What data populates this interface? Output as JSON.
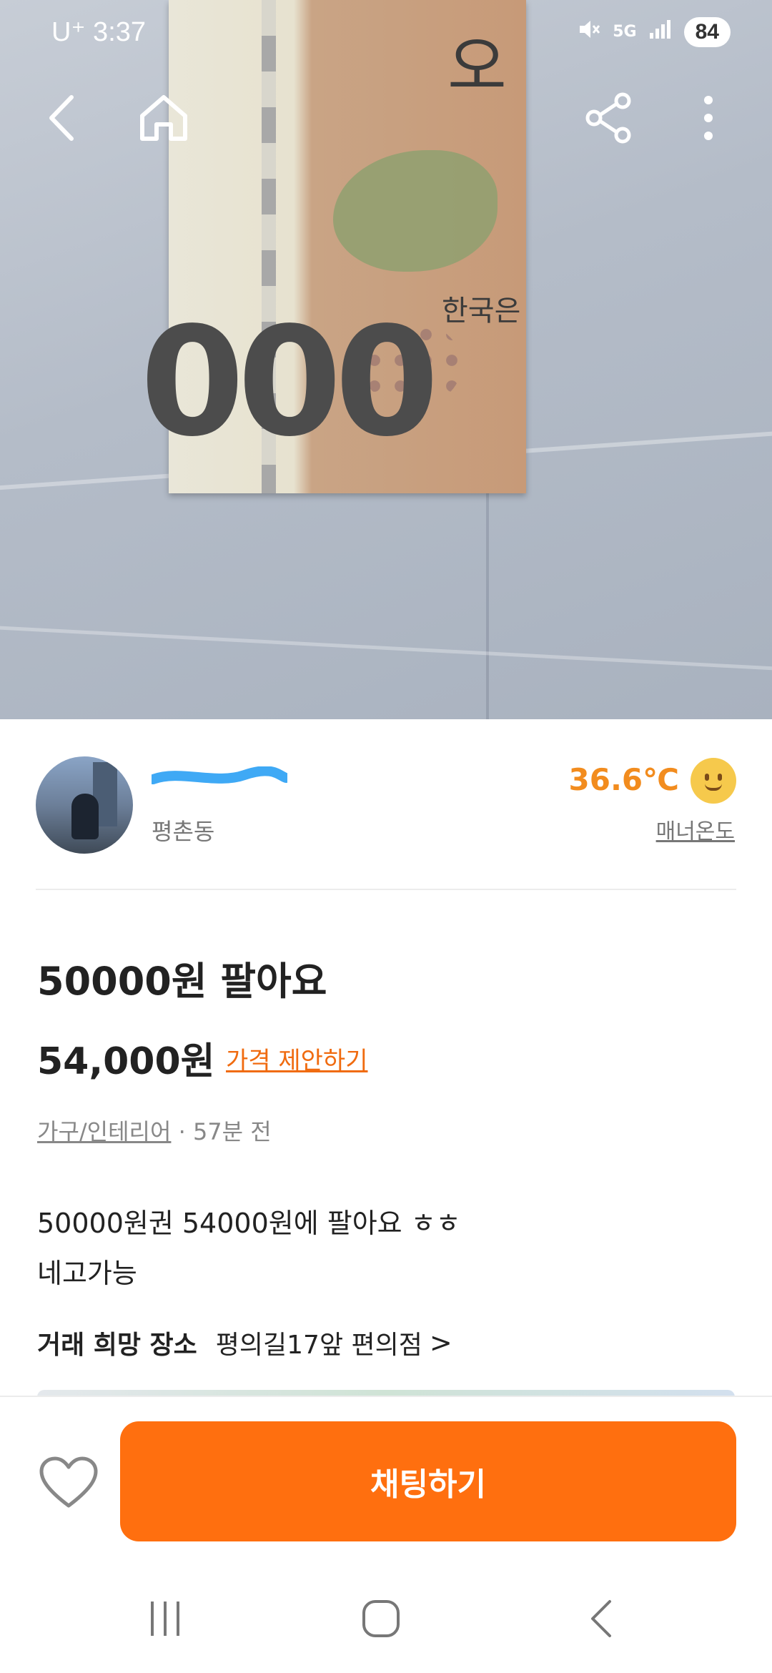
{
  "status_bar": {
    "carrier": "U⁺ 3:37",
    "network": "5G",
    "battery": "84",
    "icons": [
      "mute-icon",
      "5g-icon",
      "signal-icon",
      "battery-icon"
    ]
  },
  "photo": {
    "banknote_digits": "000",
    "banknote_text": "한국은",
    "banknote_corner": "오"
  },
  "toolbar": {
    "icons": [
      "back-icon",
      "home-icon",
      "share-icon",
      "more-icon"
    ]
  },
  "profile": {
    "neighborhood": "평촌동",
    "manner_temperature": "36.6℃",
    "manner_label": "매너온도",
    "accent_color": "#f28c1e"
  },
  "listing": {
    "title": "50000원 팔아요",
    "price": "54,000원",
    "offer_label": "가격 제안하기",
    "category": "가구/인테리어",
    "separator": "·",
    "time_ago": "57분 전",
    "description_lines": [
      "50000원권 54000원에 팔아요 ㅎㅎ",
      "네고가능"
    ],
    "place_label": "거래 희망 장소",
    "place_value": "평의길17앞 편의점",
    "place_chevron": ">"
  },
  "action_bar": {
    "chat_label": "채팅하기",
    "chat_color": "#ff6f0f",
    "icons": [
      "heart-icon"
    ]
  },
  "nav_bar": {
    "icons": [
      "recent-apps-icon",
      "home-nav-icon",
      "back-nav-icon"
    ]
  }
}
